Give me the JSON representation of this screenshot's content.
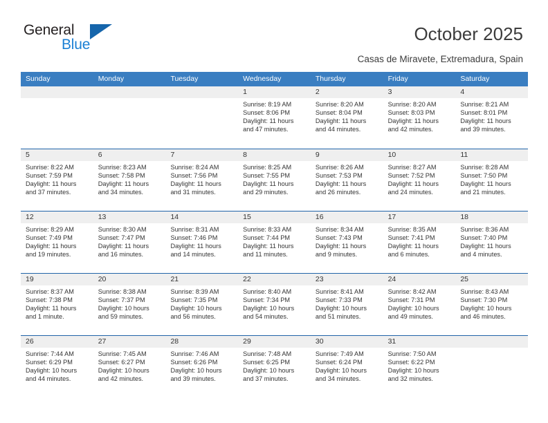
{
  "brand": {
    "name_top": "General",
    "name_bottom": "Blue",
    "triangle_color": "#1565ab",
    "blue_text_color": "#1a7fd4"
  },
  "header": {
    "title": "October 2025",
    "subtitle": "Casas de Miravete, Extremadura, Spain"
  },
  "theme": {
    "header_blue": "#3a7ec1",
    "separator_blue": "#1f63a8",
    "day_band_gray": "#efefef",
    "text_color": "#333333"
  },
  "weekdays": [
    "Sunday",
    "Monday",
    "Tuesday",
    "Wednesday",
    "Thursday",
    "Friday",
    "Saturday"
  ],
  "weeks": [
    [
      {
        "day": "",
        "lines": []
      },
      {
        "day": "",
        "lines": []
      },
      {
        "day": "",
        "lines": []
      },
      {
        "day": "1",
        "lines": [
          "Sunrise: 8:19 AM",
          "Sunset: 8:06 PM",
          "Daylight: 11 hours",
          "and 47 minutes."
        ]
      },
      {
        "day": "2",
        "lines": [
          "Sunrise: 8:20 AM",
          "Sunset: 8:04 PM",
          "Daylight: 11 hours",
          "and 44 minutes."
        ]
      },
      {
        "day": "3",
        "lines": [
          "Sunrise: 8:20 AM",
          "Sunset: 8:03 PM",
          "Daylight: 11 hours",
          "and 42 minutes."
        ]
      },
      {
        "day": "4",
        "lines": [
          "Sunrise: 8:21 AM",
          "Sunset: 8:01 PM",
          "Daylight: 11 hours",
          "and 39 minutes."
        ]
      }
    ],
    [
      {
        "day": "5",
        "lines": [
          "Sunrise: 8:22 AM",
          "Sunset: 7:59 PM",
          "Daylight: 11 hours",
          "and 37 minutes."
        ]
      },
      {
        "day": "6",
        "lines": [
          "Sunrise: 8:23 AM",
          "Sunset: 7:58 PM",
          "Daylight: 11 hours",
          "and 34 minutes."
        ]
      },
      {
        "day": "7",
        "lines": [
          "Sunrise: 8:24 AM",
          "Sunset: 7:56 PM",
          "Daylight: 11 hours",
          "and 31 minutes."
        ]
      },
      {
        "day": "8",
        "lines": [
          "Sunrise: 8:25 AM",
          "Sunset: 7:55 PM",
          "Daylight: 11 hours",
          "and 29 minutes."
        ]
      },
      {
        "day": "9",
        "lines": [
          "Sunrise: 8:26 AM",
          "Sunset: 7:53 PM",
          "Daylight: 11 hours",
          "and 26 minutes."
        ]
      },
      {
        "day": "10",
        "lines": [
          "Sunrise: 8:27 AM",
          "Sunset: 7:52 PM",
          "Daylight: 11 hours",
          "and 24 minutes."
        ]
      },
      {
        "day": "11",
        "lines": [
          "Sunrise: 8:28 AM",
          "Sunset: 7:50 PM",
          "Daylight: 11 hours",
          "and 21 minutes."
        ]
      }
    ],
    [
      {
        "day": "12",
        "lines": [
          "Sunrise: 8:29 AM",
          "Sunset: 7:49 PM",
          "Daylight: 11 hours",
          "and 19 minutes."
        ]
      },
      {
        "day": "13",
        "lines": [
          "Sunrise: 8:30 AM",
          "Sunset: 7:47 PM",
          "Daylight: 11 hours",
          "and 16 minutes."
        ]
      },
      {
        "day": "14",
        "lines": [
          "Sunrise: 8:31 AM",
          "Sunset: 7:46 PM",
          "Daylight: 11 hours",
          "and 14 minutes."
        ]
      },
      {
        "day": "15",
        "lines": [
          "Sunrise: 8:33 AM",
          "Sunset: 7:44 PM",
          "Daylight: 11 hours",
          "and 11 minutes."
        ]
      },
      {
        "day": "16",
        "lines": [
          "Sunrise: 8:34 AM",
          "Sunset: 7:43 PM",
          "Daylight: 11 hours",
          "and 9 minutes."
        ]
      },
      {
        "day": "17",
        "lines": [
          "Sunrise: 8:35 AM",
          "Sunset: 7:41 PM",
          "Daylight: 11 hours",
          "and 6 minutes."
        ]
      },
      {
        "day": "18",
        "lines": [
          "Sunrise: 8:36 AM",
          "Sunset: 7:40 PM",
          "Daylight: 11 hours",
          "and 4 minutes."
        ]
      }
    ],
    [
      {
        "day": "19",
        "lines": [
          "Sunrise: 8:37 AM",
          "Sunset: 7:38 PM",
          "Daylight: 11 hours",
          "and 1 minute."
        ]
      },
      {
        "day": "20",
        "lines": [
          "Sunrise: 8:38 AM",
          "Sunset: 7:37 PM",
          "Daylight: 10 hours",
          "and 59 minutes."
        ]
      },
      {
        "day": "21",
        "lines": [
          "Sunrise: 8:39 AM",
          "Sunset: 7:35 PM",
          "Daylight: 10 hours",
          "and 56 minutes."
        ]
      },
      {
        "day": "22",
        "lines": [
          "Sunrise: 8:40 AM",
          "Sunset: 7:34 PM",
          "Daylight: 10 hours",
          "and 54 minutes."
        ]
      },
      {
        "day": "23",
        "lines": [
          "Sunrise: 8:41 AM",
          "Sunset: 7:33 PM",
          "Daylight: 10 hours",
          "and 51 minutes."
        ]
      },
      {
        "day": "24",
        "lines": [
          "Sunrise: 8:42 AM",
          "Sunset: 7:31 PM",
          "Daylight: 10 hours",
          "and 49 minutes."
        ]
      },
      {
        "day": "25",
        "lines": [
          "Sunrise: 8:43 AM",
          "Sunset: 7:30 PM",
          "Daylight: 10 hours",
          "and 46 minutes."
        ]
      }
    ],
    [
      {
        "day": "26",
        "lines": [
          "Sunrise: 7:44 AM",
          "Sunset: 6:29 PM",
          "Daylight: 10 hours",
          "and 44 minutes."
        ]
      },
      {
        "day": "27",
        "lines": [
          "Sunrise: 7:45 AM",
          "Sunset: 6:27 PM",
          "Daylight: 10 hours",
          "and 42 minutes."
        ]
      },
      {
        "day": "28",
        "lines": [
          "Sunrise: 7:46 AM",
          "Sunset: 6:26 PM",
          "Daylight: 10 hours",
          "and 39 minutes."
        ]
      },
      {
        "day": "29",
        "lines": [
          "Sunrise: 7:48 AM",
          "Sunset: 6:25 PM",
          "Daylight: 10 hours",
          "and 37 minutes."
        ]
      },
      {
        "day": "30",
        "lines": [
          "Sunrise: 7:49 AM",
          "Sunset: 6:24 PM",
          "Daylight: 10 hours",
          "and 34 minutes."
        ]
      },
      {
        "day": "31",
        "lines": [
          "Sunrise: 7:50 AM",
          "Sunset: 6:22 PM",
          "Daylight: 10 hours",
          "and 32 minutes."
        ]
      },
      {
        "day": "",
        "lines": []
      }
    ]
  ]
}
